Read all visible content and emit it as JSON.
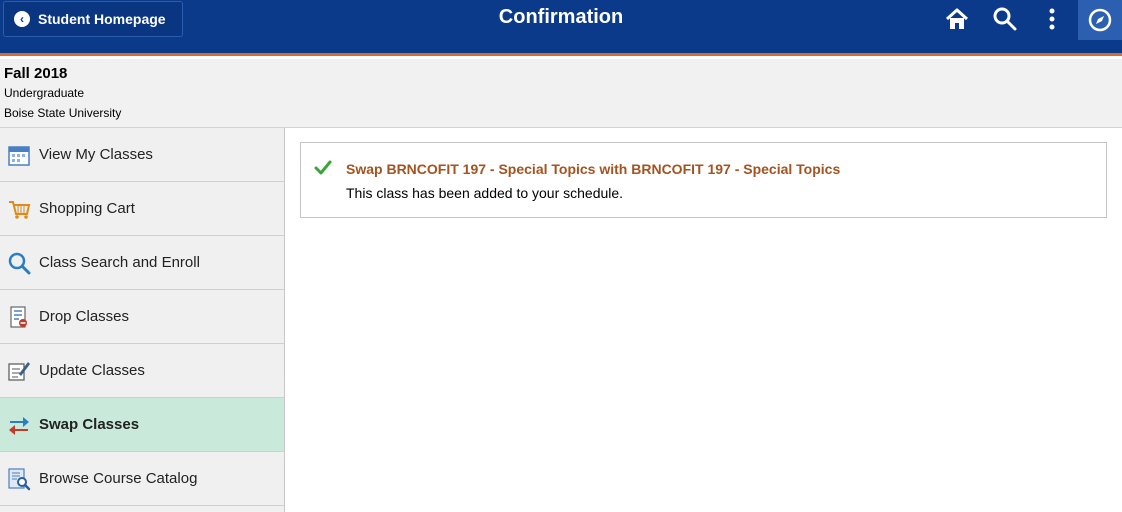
{
  "header": {
    "back_label": "Student Homepage",
    "title": "Confirmation",
    "icons": [
      "home-icon",
      "search-icon",
      "more-icon",
      "navbar-icon"
    ],
    "colors": {
      "bar": "#0b3a8a",
      "accent": "#d86c2e"
    }
  },
  "term": {
    "name": "Fall 2018",
    "career": "Undergraduate",
    "institution": "Boise State University"
  },
  "sidebar": {
    "items": [
      {
        "label": "View My Classes",
        "icon": "calendar-icon"
      },
      {
        "label": "Shopping Cart",
        "icon": "shopping-cart-icon"
      },
      {
        "label": "Class Search and Enroll",
        "icon": "magnifier-icon"
      },
      {
        "label": "Drop Classes",
        "icon": "drop-list-icon"
      },
      {
        "label": "Update Classes",
        "icon": "edit-document-icon"
      },
      {
        "label": "Swap Classes",
        "icon": "swap-arrows-icon",
        "active": true
      },
      {
        "label": "Browse Course Catalog",
        "icon": "catalog-icon"
      }
    ]
  },
  "message": {
    "title": "Swap BRNCOFIT  197 - Special Topics with BRNCOFIT  197 - Special Topics",
    "text": "This class has been added to your schedule.",
    "status_icon": "check-icon"
  }
}
